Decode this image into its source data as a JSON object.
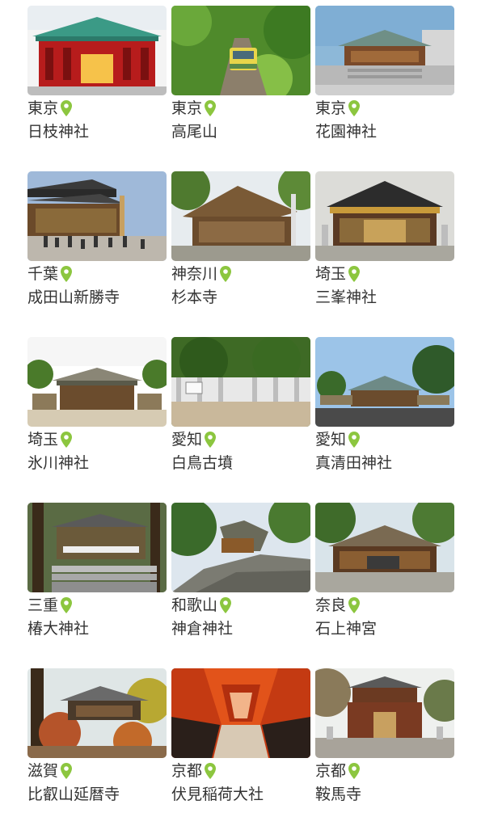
{
  "colors": {
    "pin": "#8cc63f",
    "text": "#333333",
    "background": "#ffffff"
  },
  "icons": {
    "location": "map-pin-icon"
  },
  "items": [
    {
      "prefecture": "東京",
      "name": "日枝神社",
      "scene": "red-shrine"
    },
    {
      "prefecture": "東京",
      "name": "高尾山",
      "scene": "cable-car"
    },
    {
      "prefecture": "東京",
      "name": "花園神社",
      "scene": "urban-shrine"
    },
    {
      "prefecture": "千葉",
      "name": "成田山新勝寺",
      "scene": "temple-crowd"
    },
    {
      "prefecture": "神奈川",
      "name": "杉本寺",
      "scene": "thatched-temple"
    },
    {
      "prefecture": "埼玉",
      "name": "三峯神社",
      "scene": "ornate-shrine"
    },
    {
      "prefecture": "埼玉",
      "name": "氷川神社",
      "scene": "wide-shrine"
    },
    {
      "prefecture": "愛知",
      "name": "白鳥古墳",
      "scene": "fenced-mound"
    },
    {
      "prefecture": "愛知",
      "name": "真清田神社",
      "scene": "shrine-sky"
    },
    {
      "prefecture": "三重",
      "name": "椿大神社",
      "scene": "forest-shrine"
    },
    {
      "prefecture": "和歌山",
      "name": "神倉神社",
      "scene": "rock-shrine"
    },
    {
      "prefecture": "奈良",
      "name": "石上神宮",
      "scene": "green-shrine"
    },
    {
      "prefecture": "滋賀",
      "name": "比叡山延暦寺",
      "scene": "autumn-temple"
    },
    {
      "prefecture": "京都",
      "name": "伏見稲荷大社",
      "scene": "torii-tunnel"
    },
    {
      "prefecture": "京都",
      "name": "鞍馬寺",
      "scene": "gate-temple"
    }
  ]
}
